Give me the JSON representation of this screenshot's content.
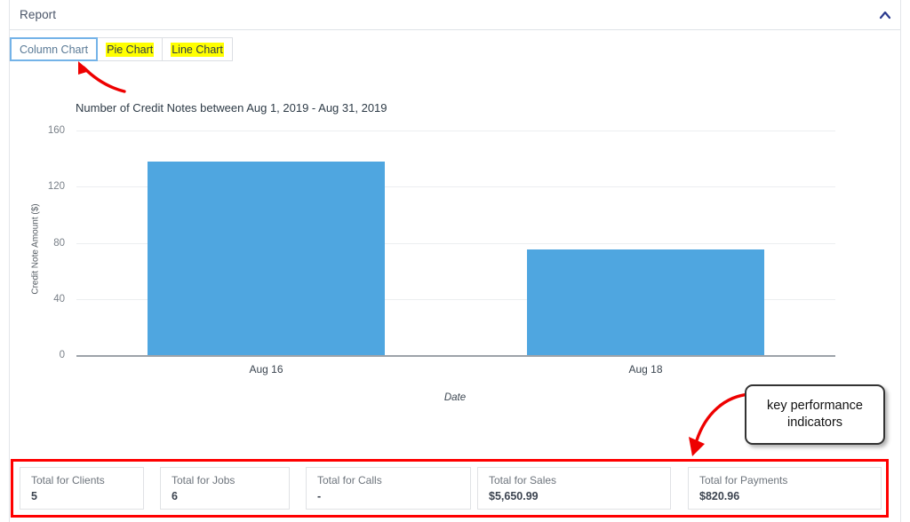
{
  "header": {
    "title": "Report",
    "collapse_icon": "chevron-up-icon",
    "chevron_color": "#2b3a8f"
  },
  "tabs": [
    {
      "label": "Column Chart",
      "active": true,
      "highlighted": false
    },
    {
      "label": "Pie Chart",
      "active": false,
      "highlighted": true
    },
    {
      "label": "Line Chart",
      "active": false,
      "highlighted": true
    }
  ],
  "annotations": {
    "tab_arrow": "red-arrow-to-column-chart-tab",
    "kpi_arrow": "red-curved-arrow-to-kpi-row",
    "callout_text": "key performance indicators",
    "highlight_color": "#ff0000"
  },
  "chart_data": {
    "type": "bar",
    "title": "Number of Credit Notes between Aug 1, 2019 - Aug 31, 2019",
    "xlabel": "Date",
    "ylabel": "Credit Note Amount ($)",
    "categories": [
      "Aug 16",
      "Aug 18"
    ],
    "values": [
      138,
      75
    ],
    "ylim": [
      0,
      160
    ],
    "yticks": [
      0,
      40,
      80,
      120,
      160
    ],
    "ytick_labels": [
      "0",
      "40",
      "80",
      "120",
      "160"
    ],
    "grid": true,
    "legend": "none",
    "series_color": "#4fa6e0"
  },
  "kpis": [
    {
      "label": "Total for Clients",
      "value": "5"
    },
    {
      "label": "Total for Jobs",
      "value": "6"
    },
    {
      "label": "Total for Calls",
      "value": "-"
    },
    {
      "label": "Total for Sales",
      "value": "$5,650.99"
    },
    {
      "label": "Total for Payments",
      "value": "$820.96"
    }
  ]
}
